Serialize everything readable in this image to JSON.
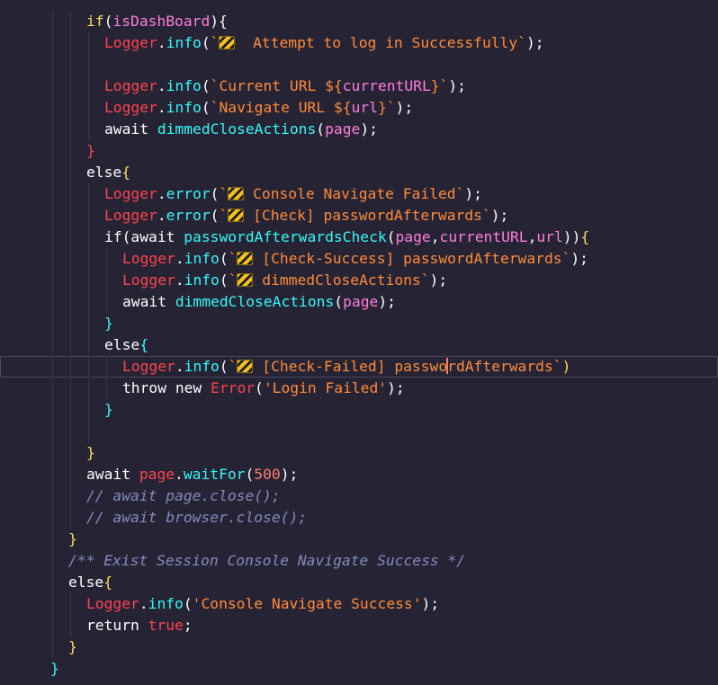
{
  "theme": {
    "background": "#262335",
    "keyword": "#fede5d",
    "object": "#fe4450",
    "method": "#36f9f6",
    "string": "#ff8b39",
    "variable": "#ff7edb",
    "comment": "#848bbd",
    "plain": "#fefefe",
    "number": "#f97e72"
  },
  "editor": {
    "lines": [
      {
        "indent": 1,
        "current": false,
        "tokens": [
          [
            "k",
            "if"
          ],
          [
            "p",
            "("
          ],
          [
            "v",
            "isDashBoard"
          ],
          [
            "p",
            "){"
          ]
        ]
      },
      {
        "indent": 2,
        "current": false,
        "tokens": [
          [
            "o",
            "Logger"
          ],
          [
            "p",
            "."
          ],
          [
            "m",
            "info"
          ],
          [
            "p",
            "("
          ],
          [
            "s",
            "`"
          ],
          [
            "i",
            "construction-sign"
          ],
          [
            "s",
            "  Attempt to log in Successfully`"
          ],
          [
            "p",
            ");"
          ]
        ]
      },
      {
        "indent": 2,
        "current": false,
        "tokens": []
      },
      {
        "indent": 2,
        "current": false,
        "tokens": [
          [
            "o",
            "Logger"
          ],
          [
            "p",
            "."
          ],
          [
            "m",
            "info"
          ],
          [
            "p",
            "("
          ],
          [
            "s",
            "`Current URL ${"
          ],
          [
            "v",
            "currentURL"
          ],
          [
            "s",
            "}`"
          ],
          [
            "p",
            ");"
          ]
        ]
      },
      {
        "indent": 2,
        "current": false,
        "tokens": [
          [
            "o",
            "Logger"
          ],
          [
            "p",
            "."
          ],
          [
            "m",
            "info"
          ],
          [
            "p",
            "("
          ],
          [
            "s",
            "`Navigate URL ${"
          ],
          [
            "v",
            "url"
          ],
          [
            "s",
            "}`"
          ],
          [
            "p",
            ");"
          ]
        ]
      },
      {
        "indent": 2,
        "current": false,
        "tokens": [
          [
            "p",
            "await "
          ],
          [
            "m",
            "dimmedCloseActions"
          ],
          [
            "p",
            "("
          ],
          [
            "v",
            "page"
          ],
          [
            "p",
            ");"
          ]
        ]
      },
      {
        "indent": 1,
        "current": false,
        "tokens": [
          [
            "o",
            "}"
          ]
        ]
      },
      {
        "indent": 1,
        "current": false,
        "tokens": [
          [
            "p",
            "else"
          ],
          [
            "k",
            "{"
          ]
        ]
      },
      {
        "indent": 2,
        "current": false,
        "tokens": [
          [
            "o",
            "Logger"
          ],
          [
            "p",
            "."
          ],
          [
            "m",
            "error"
          ],
          [
            "p",
            "("
          ],
          [
            "s",
            "`"
          ],
          [
            "i",
            "construction-sign"
          ],
          [
            "s",
            " Console Navigate Failed`"
          ],
          [
            "p",
            ");"
          ]
        ]
      },
      {
        "indent": 2,
        "current": false,
        "tokens": [
          [
            "o",
            "Logger"
          ],
          [
            "p",
            "."
          ],
          [
            "m",
            "error"
          ],
          [
            "p",
            "("
          ],
          [
            "s",
            "`"
          ],
          [
            "i",
            "construction-sign"
          ],
          [
            "s",
            " [Check] passwordAfterwards`"
          ],
          [
            "p",
            ");"
          ]
        ]
      },
      {
        "indent": 2,
        "current": false,
        "tokens": [
          [
            "p",
            "if(await "
          ],
          [
            "m",
            "passwordAfterwardsCheck"
          ],
          [
            "p",
            "("
          ],
          [
            "v",
            "page"
          ],
          [
            "p",
            ","
          ],
          [
            "v",
            "currentURL"
          ],
          [
            "p",
            ","
          ],
          [
            "v",
            "url"
          ],
          [
            "p",
            "))"
          ],
          [
            "k",
            "{"
          ]
        ]
      },
      {
        "indent": 3,
        "current": false,
        "tokens": [
          [
            "o",
            "Logger"
          ],
          [
            "p",
            "."
          ],
          [
            "m",
            "info"
          ],
          [
            "p",
            "("
          ],
          [
            "s",
            "`"
          ],
          [
            "i",
            "construction-sign"
          ],
          [
            "s",
            " [Check-Success] passwordAfterwards`"
          ],
          [
            "p",
            ");"
          ]
        ]
      },
      {
        "indent": 3,
        "current": false,
        "tokens": [
          [
            "o",
            "Logger"
          ],
          [
            "p",
            "."
          ],
          [
            "m",
            "info"
          ],
          [
            "p",
            "("
          ],
          [
            "s",
            "`"
          ],
          [
            "i",
            "construction-sign"
          ],
          [
            "s",
            " dimmedCloseActions`"
          ],
          [
            "p",
            ");"
          ]
        ]
      },
      {
        "indent": 3,
        "current": false,
        "tokens": [
          [
            "p",
            "await "
          ],
          [
            "m",
            "dimmedCloseActions"
          ],
          [
            "p",
            "("
          ],
          [
            "v",
            "page"
          ],
          [
            "p",
            ");"
          ]
        ]
      },
      {
        "indent": 2,
        "current": false,
        "tokens": [
          [
            "m",
            "}"
          ]
        ]
      },
      {
        "indent": 2,
        "current": false,
        "tokens": [
          [
            "p",
            "else"
          ],
          [
            "m",
            "{"
          ]
        ]
      },
      {
        "indent": 3,
        "current": true,
        "tokens": [
          [
            "o",
            "Logger"
          ],
          [
            "p",
            "."
          ],
          [
            "m",
            "info"
          ],
          [
            "p",
            "("
          ],
          [
            "s",
            "`"
          ],
          [
            "i",
            "construction-sign"
          ],
          [
            "s",
            " [Check-Failed] passwo"
          ],
          [
            "c",
            ""
          ],
          [
            "s",
            "rdAfterwards`"
          ],
          [
            "k",
            ")"
          ]
        ]
      },
      {
        "indent": 3,
        "current": false,
        "tokens": [
          [
            "p",
            "throw new "
          ],
          [
            "o",
            "Error"
          ],
          [
            "p",
            "("
          ],
          [
            "s",
            "'Login Failed'"
          ],
          [
            "p",
            ");"
          ]
        ]
      },
      {
        "indent": 2,
        "current": false,
        "tokens": [
          [
            "m",
            "}"
          ]
        ]
      },
      {
        "indent": 2,
        "current": false,
        "tokens": []
      },
      {
        "indent": 1,
        "current": false,
        "tokens": [
          [
            "k",
            "}"
          ]
        ]
      },
      {
        "indent": 1,
        "current": false,
        "tokens": [
          [
            "p",
            "await "
          ],
          [
            "o",
            "page"
          ],
          [
            "p",
            "."
          ],
          [
            "m",
            "waitFor"
          ],
          [
            "p",
            "("
          ],
          [
            "n",
            "500"
          ],
          [
            "p",
            ");"
          ]
        ]
      },
      {
        "indent": 1,
        "current": false,
        "tokens": [
          [
            "c2",
            "// await page.close();"
          ]
        ]
      },
      {
        "indent": 1,
        "current": false,
        "tokens": [
          [
            "c2",
            "// await browser.close();"
          ]
        ]
      },
      {
        "indent": 0,
        "current": false,
        "tokens": [
          [
            "k",
            "}"
          ]
        ]
      },
      {
        "indent": 0,
        "current": false,
        "tokens": [
          [
            "c2",
            "/** Exist Session Console Navigate Success */"
          ]
        ]
      },
      {
        "indent": 0,
        "current": false,
        "tokens": [
          [
            "p",
            "else"
          ],
          [
            "k",
            "{"
          ]
        ]
      },
      {
        "indent": 1,
        "current": false,
        "tokens": [
          [
            "o",
            "Logger"
          ],
          [
            "p",
            "."
          ],
          [
            "m",
            "info"
          ],
          [
            "p",
            "("
          ],
          [
            "s",
            "'Console Navigate Success'"
          ],
          [
            "p",
            ");"
          ]
        ]
      },
      {
        "indent": 1,
        "current": false,
        "tokens": [
          [
            "p",
            "return "
          ],
          [
            "o",
            "true"
          ],
          [
            "p",
            ";"
          ]
        ]
      },
      {
        "indent": 0,
        "current": false,
        "tokens": [
          [
            "k",
            "}"
          ]
        ]
      },
      {
        "indent": -1,
        "current": false,
        "tokens": [
          [
            "m",
            "}"
          ]
        ]
      }
    ]
  }
}
